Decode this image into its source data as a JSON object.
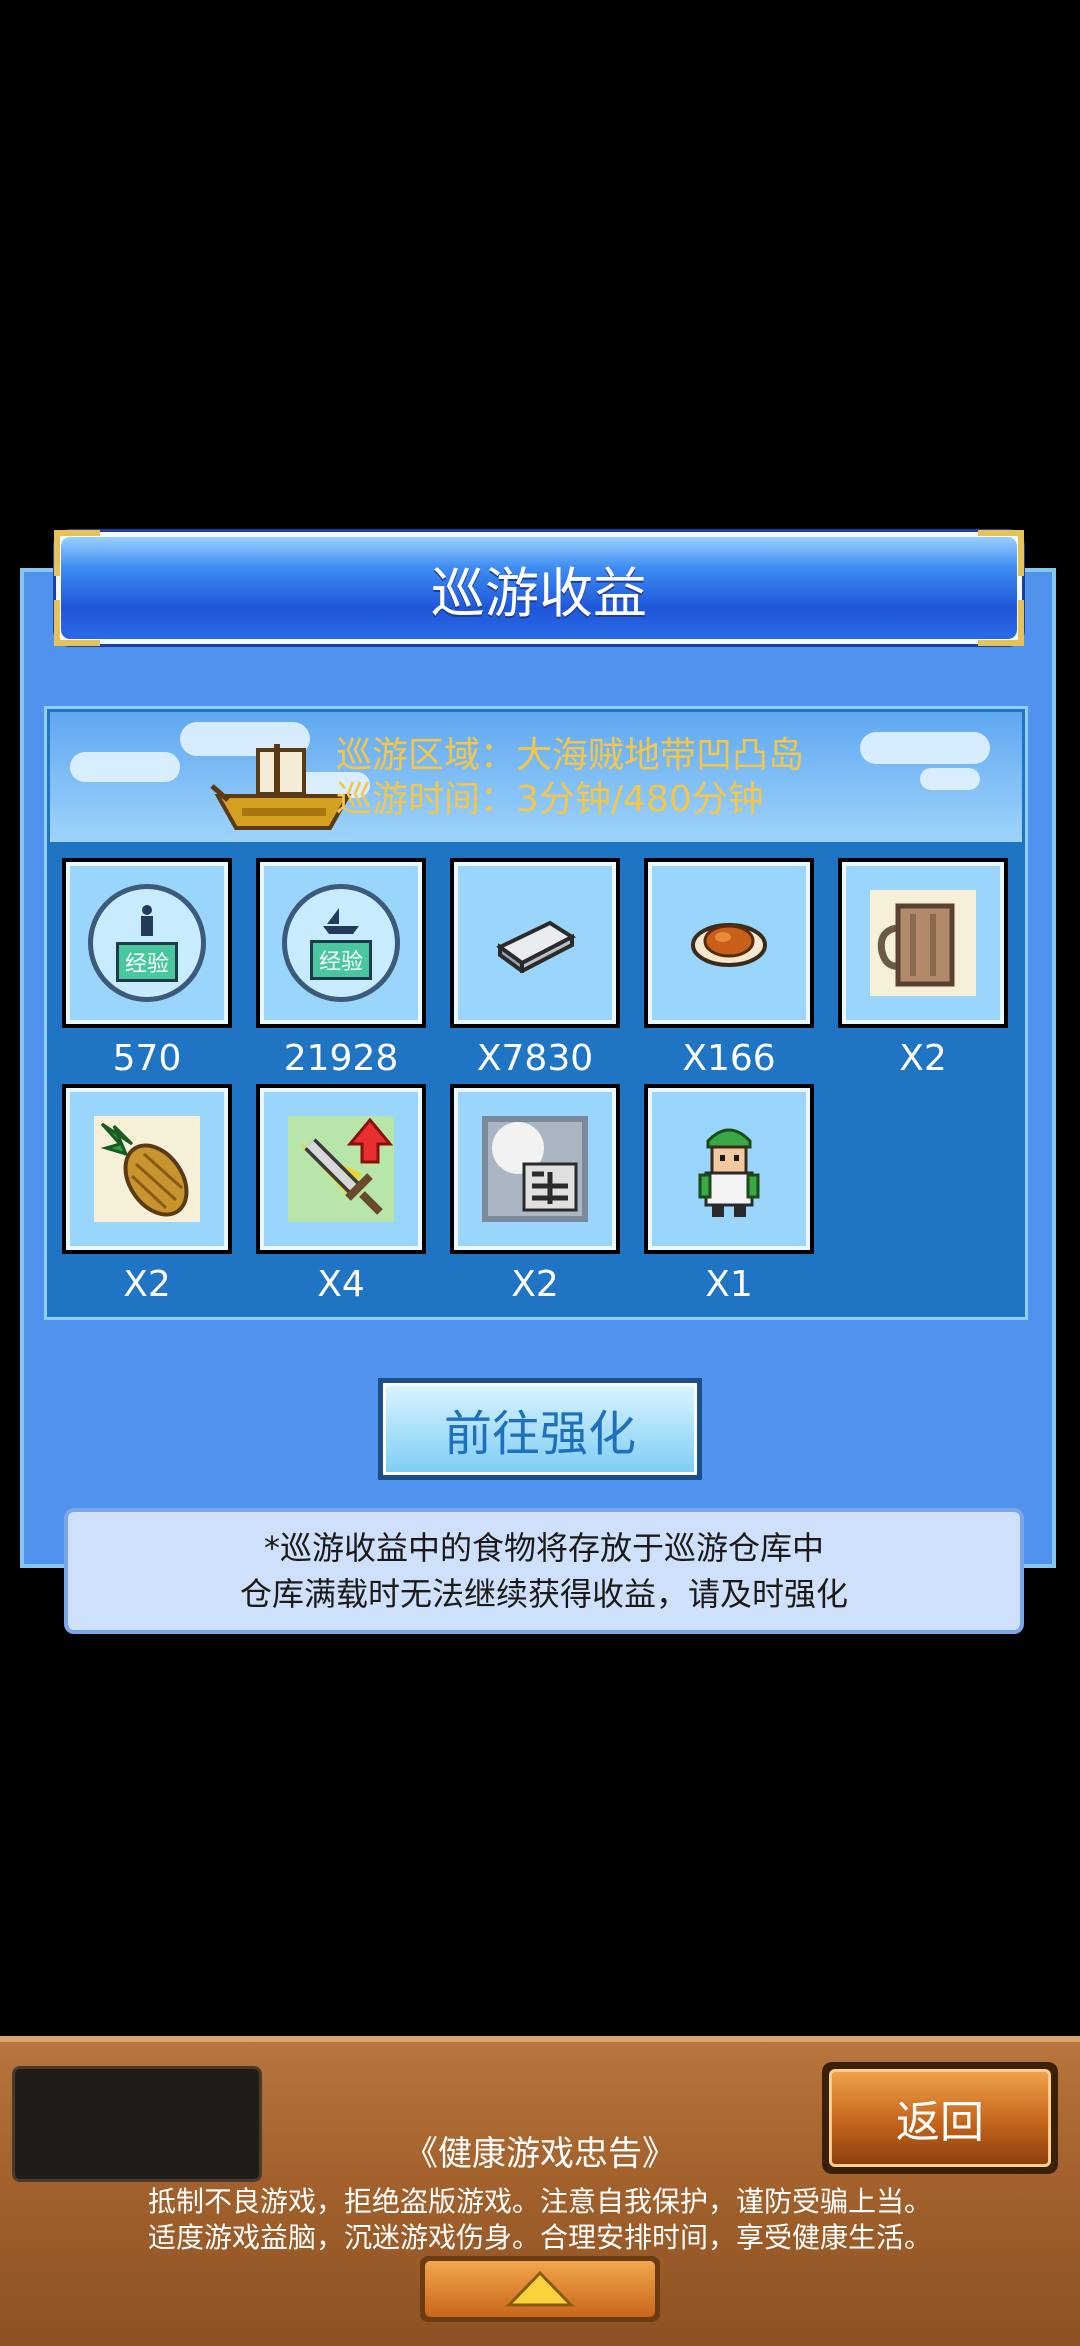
{
  "dialog": {
    "title": "巡游收益",
    "area_line": "巡游区域：大海贼地带凹凸岛",
    "time_line": "巡游时间：3分钟/480分钟",
    "badge_label": "经验",
    "items": [
      {
        "icon": "person-exp-badge-icon",
        "count": "570"
      },
      {
        "icon": "ship-exp-badge-icon",
        "count": "21928"
      },
      {
        "icon": "silver-ingot-icon",
        "count": "X7830"
      },
      {
        "icon": "roast-meat-icon",
        "count": "X166"
      },
      {
        "icon": "wooden-mug-icon",
        "count": "X2"
      },
      {
        "icon": "pineapple-icon",
        "count": "X2"
      },
      {
        "icon": "sword-upgrade-icon",
        "count": "X4"
      },
      {
        "icon": "silver-card-icon",
        "count": "X2"
      },
      {
        "icon": "green-pirate-character-icon",
        "count": "X1"
      }
    ],
    "upgrade_button": "前往强化",
    "note_line1": "*巡游收益中的食物将存放于巡游仓库中",
    "note_line2": "仓库满载时无法继续获得收益，请及时强化"
  },
  "footer": {
    "back_button": "返回",
    "health_title": "《健康游戏忠告》",
    "health_line1": "抵制不良游戏，拒绝盗版游戏。注意自我保护，谨防受骗上当。",
    "health_line2": "适度游戏益脑，沉迷游戏伤身。合理安排时间，享受健康生活。",
    "up_icon": "up-arrow-icon"
  },
  "colors": {
    "panel_blue": "#4f93ee",
    "inner_blue": "#1f74c3",
    "banner_text": "#f4c64a",
    "footer_wood": "#a5632d"
  }
}
